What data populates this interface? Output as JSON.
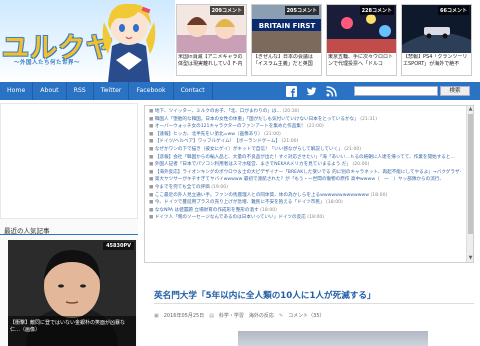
{
  "site": {
    "logo_text": "ユルクヤル",
    "logo_sub": "〜外国人たち何た世界〜"
  },
  "featured": [
    {
      "comments": "209コメント",
      "title": "米国in消滅【アニメキャラの体型は現実離れしてい】F-内"
    },
    {
      "comments": "205コメント",
      "title": "【ぎぜんな】日本の会議は「イスラム主義」だと英国"
    },
    {
      "comments": "228コメント",
      "title": "東京五輪、手に次々ウロロトンで代理投票へ「ドルコ"
    },
    {
      "comments": "66コメント",
      "title": "【悲報】PS4「クランツーリエSPORT」が海外で絶不"
    }
  ],
  "featured_brand_text": "BRITAIN FIRST",
  "nav": {
    "items": [
      "Home",
      "About",
      "RSS",
      "Twitter",
      "Facebook",
      "Contact"
    ],
    "search_label": "検索"
  },
  "sidebar": {
    "popular_heading": "最近の人気記事",
    "card_pv": "45830PV",
    "card_caption": "【衝撃】敵同に登ではいない金銀朴の笑面が凶暴な仁…（画像）"
  },
  "headlines": [
    {
      "text": "地下、ツイッター、ミルクのお子、「北、口がまわりの」は…",
      "count": "(20:30)"
    },
    {
      "text": "韓国人「堕胎的な韓国。日本の女性の体重」「国がだしも気付いていけない日本をとっているかな」 ",
      "count": "(21:31)"
    },
    {
      "text": "オーバーウォッチ女の121キャラクターのファンアートを集めた作品集！",
      "count": "(21:00)"
    },
    {
      "text": "【速報】ヒッカ、北半先をい弟北=ww（画像あり）",
      "count": "(21:00)"
    },
    {
      "text": "【ドイツ/ヘルベア】ワッフルゲイム！【ボーランドゲーム】",
      "count": "(21:00)"
    },
    {
      "text": "なぜかワンの下で描き（彼女にゲイ）がキットで自信！「いい感ながらして解説していく」",
      "count": "(21:00)"
    },
    {
      "text": "【悲報】会社「韓国からの輸入品と、大量の不良品が出た！すぐ対応させたい」「海「あいい…ｈるの純朝に人達を帰ってて、作業を開始すると…",
      "count": ""
    },
    {
      "text": "外国人記者「日本でパソコン利用者はスマホ経営、まさでNEKAAメリカを見ていまるよう だ」",
      "count": "(20:00)"
    },
    {
      "text": "【海外反応】ライオンキングのポウロウ＆士の大ピデザイナー「BREAKした受いでる 的に別のキャラネット、再起不能にしてやるよ」→バクグラザー",
      "count": ""
    },
    {
      "text": "第大ヤツサーがキチすぎてヤバイwwwww 最初で渡航された？が「もう・ー世間の傷物の原作 高中wwww（｀ー｀）ヤッ部隊からの流行、",
      "count": ""
    },
    {
      "text": "今までを完ても全ての評価",
      "count": "(19:00)"
    },
    {
      "text": "ここ最近の外人見立通い手。ファンの馬鹿理人との同体質、体の為かしらを上るwwwwwwwwwwwww",
      "count": "(18:00)"
    },
    {
      "text": "今、ドイツで蔓延用プラスの売り上げが急増、難民に不安を抱える「ドイツ市民」",
      "count": "(18:00)"
    },
    {
      "text": "ななNPA は値置題 立場財育の作成形を整形の酒す",
      "count": "(18:00)"
    },
    {
      "text": "ドイツ人「俺のソーセージなんであるのは日本いっていい」ドイツの反応",
      "count": "(18:00)"
    }
  ],
  "article": {
    "title": "英名門大学「5年以内に全人類の10人に1人が死滅する」",
    "date": "2016年05月25日",
    "category": "科学・学習　海外の反応",
    "comments": "コメント（35）"
  },
  "colors": {
    "nav_blue": "#2a72c4",
    "link_blue": "#3465a4",
    "logo_yellow": "#f1c02c"
  }
}
